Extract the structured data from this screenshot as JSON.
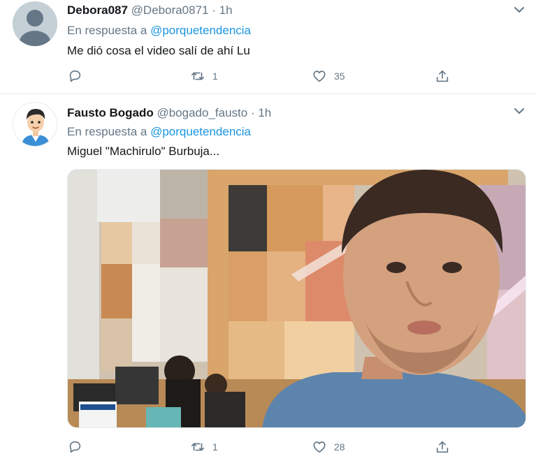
{
  "tweets": [
    {
      "display_name": "Debora087",
      "handle": "@Debora0871",
      "separator": "·",
      "time": "1h",
      "reply_prefix": "En respuesta a",
      "reply_to": "@porquetendencia",
      "text": "Me dió cosa el video salí de ahí Lu",
      "replies": "",
      "retweets": "1",
      "likes": "35",
      "avatar_icon": "default-profile-icon"
    },
    {
      "display_name": "Fausto Bogado",
      "handle": "@bogado_fausto",
      "separator": "·",
      "time": "1h",
      "reply_prefix": "En respuesta a",
      "reply_to": "@porquetendencia",
      "text": "Miguel \"Machirulo\" Burbuja...",
      "replies": "",
      "retweets": "1",
      "likes": "28",
      "avatar_icon": "cartoon-man-avatar"
    }
  ],
  "colors": {
    "text": "#14171a",
    "secondary": "#657786",
    "link": "#1b95e0",
    "divider": "#e6ecf0"
  },
  "icons": [
    "reply-icon",
    "retweet-icon",
    "like-icon",
    "share-icon",
    "chevron-down-icon"
  ]
}
